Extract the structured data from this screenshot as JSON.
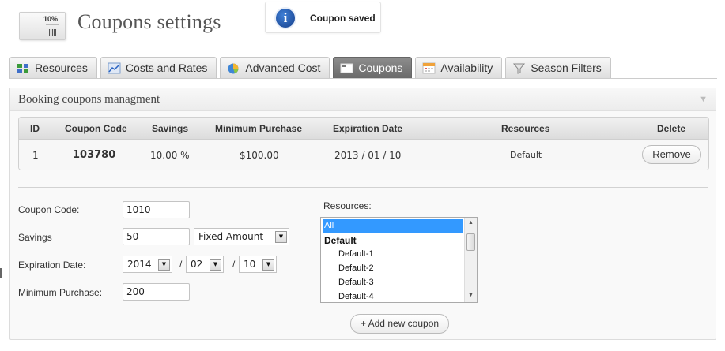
{
  "header": {
    "title": "Coupons settings",
    "icon_text": "10%",
    "notice": "Coupon saved"
  },
  "tabs": [
    {
      "label": "Resources",
      "icon": "resources-icon",
      "active": false
    },
    {
      "label": "Costs and Rates",
      "icon": "chart-icon",
      "active": false
    },
    {
      "label": "Advanced Cost",
      "icon": "pie-chart-icon",
      "active": false
    },
    {
      "label": "Coupons",
      "icon": "coupon-icon",
      "active": true
    },
    {
      "label": "Availability",
      "icon": "calendar-icon",
      "active": false
    },
    {
      "label": "Season Filters",
      "icon": "filter-icon",
      "active": false
    }
  ],
  "panel": {
    "title": "Booking coupons managment",
    "table": {
      "headers": [
        "ID",
        "Coupon Code",
        "Savings",
        "Minimum Purchase",
        "Expiration Date",
        "Resources",
        "Delete"
      ],
      "rows": [
        {
          "id": "1",
          "code": "103780",
          "savings": "10.00 %",
          "min_purchase": "$100.00",
          "expiration": "2013 / 01 / 10",
          "resources": "Default",
          "delete_label": "Remove"
        }
      ]
    },
    "form": {
      "coupon_code_label": "Coupon Code:",
      "coupon_code_value": "1010",
      "savings_label": "Savings",
      "savings_value": "50",
      "savings_type": "Fixed Amount",
      "expiration_label": "Expiration Date:",
      "exp_year": "2014",
      "exp_month": "02",
      "exp_day": "10",
      "date_separator": "/",
      "min_purchase_label": "Minimum Purchase:",
      "min_purchase_value": "200",
      "resources_label": "Resources:",
      "resources_options": [
        "All",
        "Default",
        "Default-1",
        "Default-2",
        "Default-3",
        "Default-4"
      ],
      "resources_selected": "All",
      "add_button": "+ Add new coupon"
    }
  },
  "colors": {
    "active_tab": "#7a7a7a",
    "selection": "#3399ff",
    "info_icon": "#1d4f9e"
  }
}
